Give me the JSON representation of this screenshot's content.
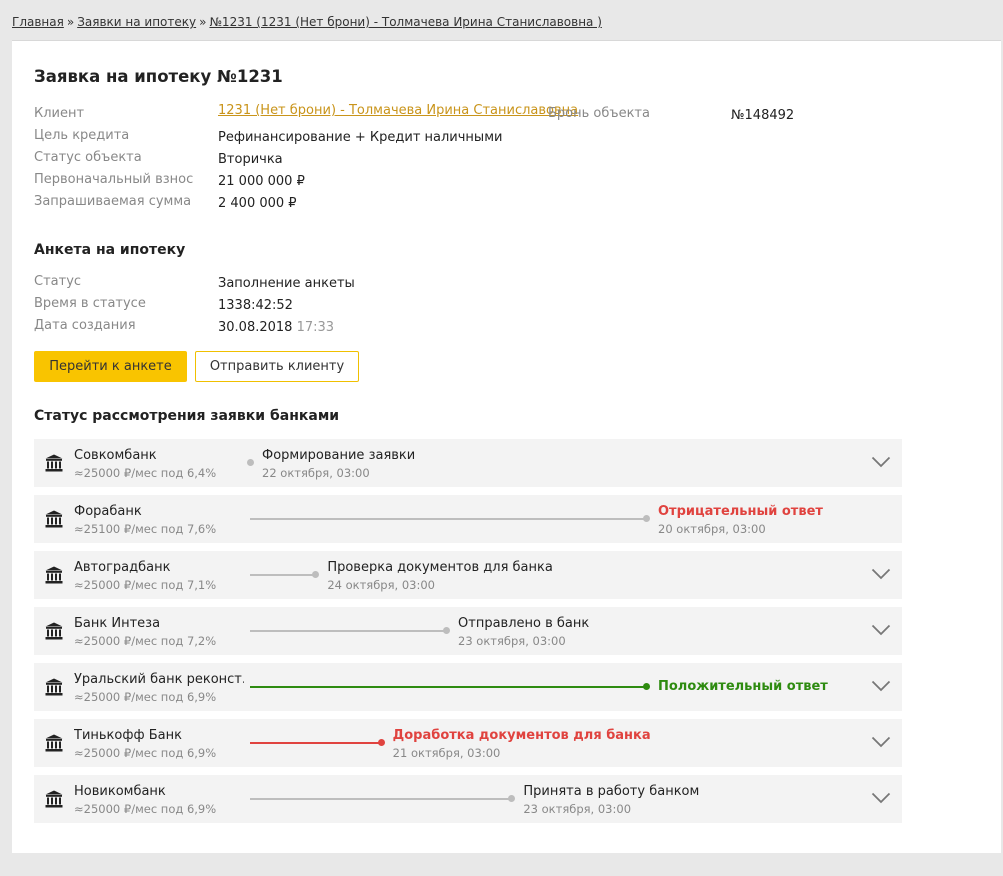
{
  "breadcrumb": {
    "home": "Главная",
    "separator": "»",
    "applications": "Заявки на ипотеку",
    "current": "№1231 (1231 (Нет брони) - Толмачева Ирина Станиславовна )"
  },
  "application": {
    "title": "Заявка на ипотеку №1231",
    "client_label": "Клиент",
    "client_value": "1231 (Нет брони) - Толмачева Ирина Станиславовна",
    "booking_label": "Бронь объекта",
    "booking_value": "№148492",
    "purpose_label": "Цель кредита",
    "purpose_value": "Рефинансирование + Кредит наличными",
    "object_status_label": "Статус объекта",
    "object_status_value": "Вторичка",
    "down_payment_label": "Первоначальный взнос",
    "down_payment_value": "21 000 000 ₽",
    "requested_amount_label": "Запрашиваемая сумма",
    "requested_amount_value": "2 400 000 ₽"
  },
  "questionnaire": {
    "title": "Анкета на ипотеку",
    "status_label": "Статус",
    "status_value": "Заполнение анкеты",
    "time_label": "Время в статусе",
    "time_value": "1338:42:52",
    "created_label": "Дата создания",
    "created_date": "30.08.2018",
    "created_time": "17:33",
    "go_button": "Перейти к анкете",
    "send_button": "Отправить клиенту"
  },
  "banks": {
    "title": "Статус рассмотрения заявки банками",
    "colors": {
      "neutral": "#bdbdbd",
      "positive": "#2e8b10",
      "negative": "#e0433f",
      "accent": "#f9c400"
    },
    "rows": [
      {
        "name": "Совкомбанк",
        "rate": "≈25000 ₽/мес под 6,4%",
        "status": "Формирование заявки",
        "date": "22 октября, 03:00",
        "kind": "neutral",
        "progress": 0,
        "expandable": true
      },
      {
        "name": "Форабанк",
        "rate": "≈25100 ₽/мес под 7,6%",
        "status": "Отрицательный ответ",
        "date": "20 октября, 03:00",
        "kind": "negative-end",
        "progress": 1,
        "expandable": false
      },
      {
        "name": "Автоградбанк",
        "rate": "≈25000 ₽/мес под 7,1%",
        "status": "Проверка документов для банка",
        "date": "24 октября, 03:00",
        "kind": "neutral",
        "progress": 0.165,
        "expandable": true
      },
      {
        "name": "Банк Интеза",
        "rate": "≈25000 ₽/мес под 7,2%",
        "status": "Отправлено в банк",
        "date": "23 октября, 03:00",
        "kind": "neutral",
        "progress": 0.495,
        "expandable": true
      },
      {
        "name": "Уральский банк реконст...",
        "rate": "≈25000 ₽/мес под 6,9%",
        "status": "Положительный ответ",
        "date": "",
        "kind": "positive",
        "progress": 1,
        "expandable": true
      },
      {
        "name": "Тинькофф Банк",
        "rate": "≈25000 ₽/мес под 6,9%",
        "status": "Доработка документов для банка",
        "date": "21 октября, 03:00",
        "kind": "negative",
        "progress": 0.33,
        "expandable": true
      },
      {
        "name": "Новикомбанк",
        "rate": "≈25000 ₽/мес под 6,9%",
        "status": "Принята в работу банком",
        "date": "23 октября, 03:00",
        "kind": "neutral",
        "progress": 0.66,
        "expandable": true
      }
    ]
  }
}
